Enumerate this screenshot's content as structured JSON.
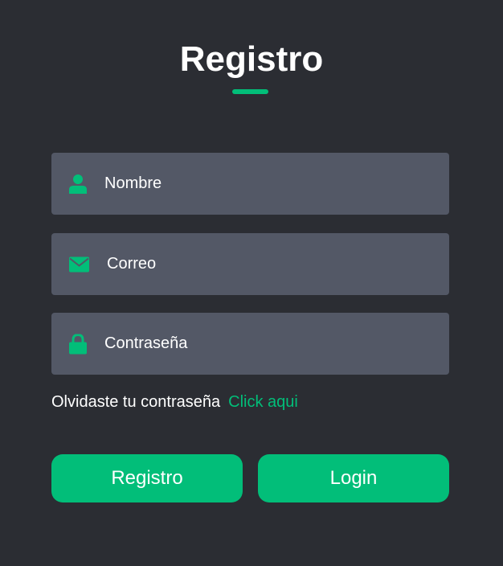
{
  "form": {
    "title": "Registro",
    "fields": {
      "name": {
        "icon": "user-icon",
        "placeholder": "Nombre",
        "value": ""
      },
      "email": {
        "icon": "envelope-icon",
        "placeholder": "Correo",
        "value": ""
      },
      "password": {
        "icon": "lock-icon",
        "placeholder": "Contraseña",
        "value": ""
      }
    },
    "forgot": {
      "text": "Olvidaste tu contraseña",
      "link": "Click aqui"
    },
    "buttons": {
      "register": "Registro",
      "login": "Login"
    }
  },
  "colors": {
    "background": "#2b2d33",
    "field": "#535866",
    "accent": "#02be79",
    "text": "#ffffff"
  }
}
